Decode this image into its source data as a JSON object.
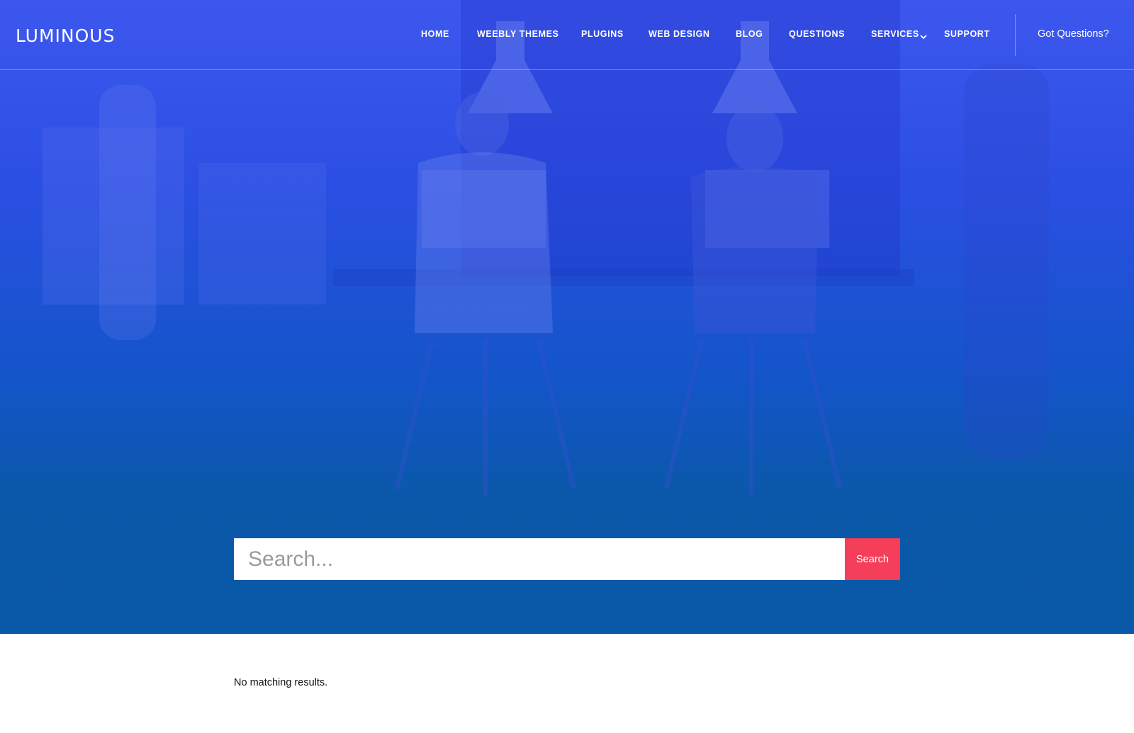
{
  "brand": {
    "logo_text": "LUMINOUS"
  },
  "nav": {
    "items": [
      {
        "label": "HOME"
      },
      {
        "label": "WEEBLY THEMES"
      },
      {
        "label": "PLUGINS"
      },
      {
        "label": "WEB DESIGN"
      },
      {
        "label": "BLOG"
      },
      {
        "label": "QUESTIONS"
      },
      {
        "label": "SERVICES",
        "icon": "chevron-down-icon"
      },
      {
        "label": "SUPPORT"
      }
    ],
    "cta_label": "Got Questions?"
  },
  "search": {
    "placeholder": "Search...",
    "value": "",
    "button_label": "Search"
  },
  "results": {
    "message": "No matching results."
  },
  "colors": {
    "hero_top": "#3d57ee",
    "hero_bottom": "#0a59a6",
    "search_button": "#f43e5a",
    "text_dark": "#111111"
  }
}
